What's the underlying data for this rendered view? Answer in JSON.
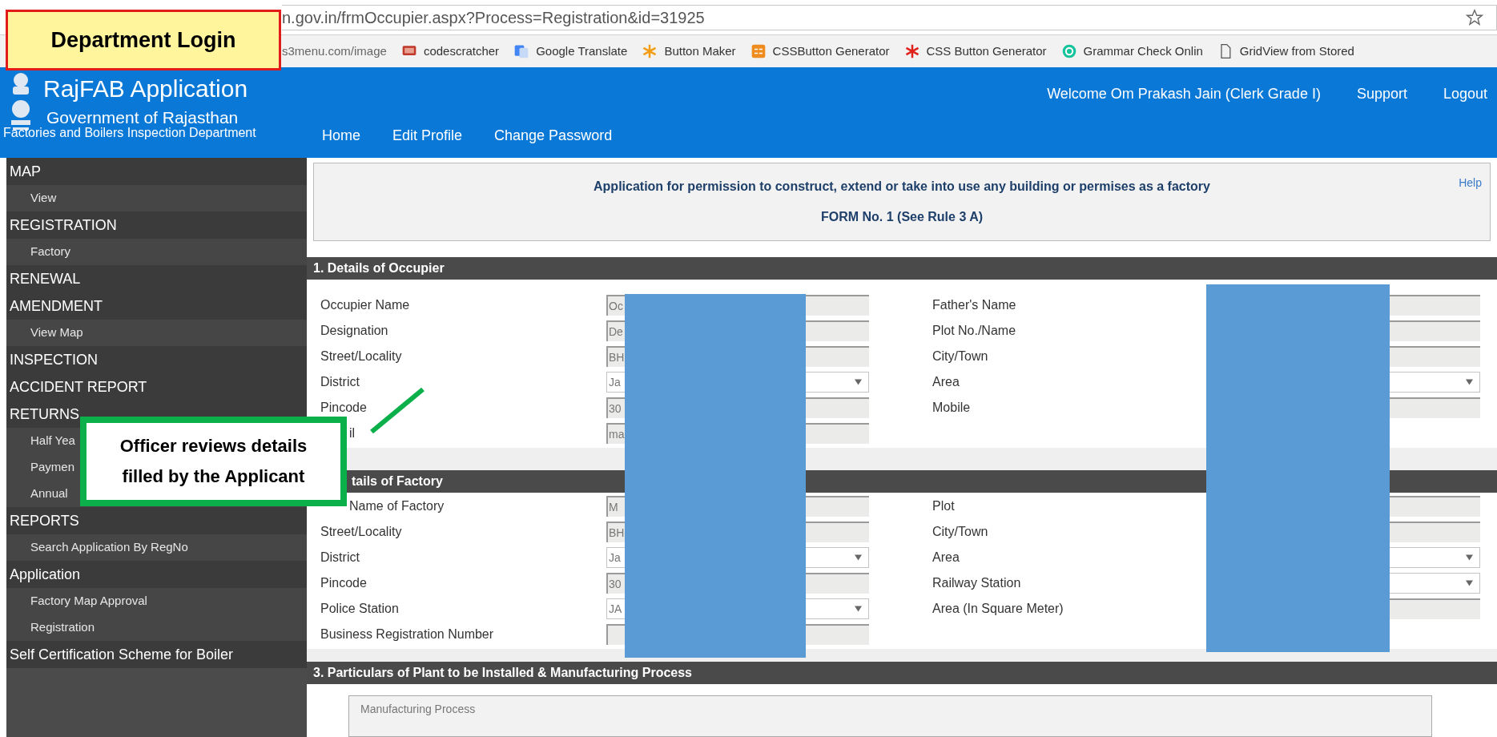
{
  "annotations": {
    "title_label": "Department Login",
    "callout": "Officer reviews details filled by the Applicant"
  },
  "browser": {
    "url": "n.gov.in/frmOccupier.aspx?Process=Registration&id=31925",
    "bookmarks": [
      {
        "label": "s3menu.com/image"
      },
      {
        "label": "codescratcher"
      },
      {
        "label": "Google Translate"
      },
      {
        "label": "Button Maker"
      },
      {
        "label": "CSSButton Generator"
      },
      {
        "label": "CSS Button Generator"
      },
      {
        "label": "Grammar Check Onlin"
      },
      {
        "label": "GridView from Stored"
      }
    ]
  },
  "header": {
    "title": "RajFAB Application",
    "subtitle": "Government of Rajasthan",
    "department": "Factories and Boilers Inspection Department",
    "nav": [
      "Home",
      "Edit Profile",
      "Change Password"
    ],
    "welcome": "Welcome Om Prakash Jain (Clerk Grade I)",
    "links": [
      "Support",
      "Logout"
    ]
  },
  "sidebar": {
    "items": [
      {
        "label": "MAP",
        "children": [
          {
            "label": "View"
          }
        ]
      },
      {
        "label": "REGISTRATION",
        "children": [
          {
            "label": "Factory"
          }
        ]
      },
      {
        "label": "RENEWAL"
      },
      {
        "label": "AMENDMENT",
        "children": [
          {
            "label": "View Map"
          }
        ]
      },
      {
        "label": "INSPECTION"
      },
      {
        "label": "ACCIDENT REPORT"
      },
      {
        "label": "RETURNS",
        "children": [
          {
            "label": "Half Yea"
          },
          {
            "label": "Paymen"
          },
          {
            "label": "Annual"
          }
        ]
      },
      {
        "label": "REPORTS",
        "children": [
          {
            "label": "Search Application By RegNo"
          }
        ]
      },
      {
        "label": "Application",
        "children": [
          {
            "label": "Factory Map Approval"
          },
          {
            "label": "Registration"
          }
        ]
      },
      {
        "label": "Self Certification Scheme for Boiler"
      }
    ]
  },
  "form": {
    "title": "Application for permission to construct, extend or take into use any building or permises as a factory",
    "subtitle": "FORM No. 1 (See Rule 3 A)",
    "help": "Help",
    "sections": [
      {
        "heading": "1. Details of Occupier",
        "partial": false,
        "left": [
          {
            "label": "Occupier Name",
            "kind": "text",
            "value": "Oc"
          },
          {
            "label": "Designation",
            "kind": "text",
            "value": "De"
          },
          {
            "label": "Street/Locality",
            "kind": "text",
            "value": "BH"
          },
          {
            "label": "District",
            "kind": "select",
            "value": "Ja"
          },
          {
            "label": "Pincode",
            "kind": "text",
            "value": "30"
          },
          {
            "label": "il",
            "partial": true,
            "kind": "text",
            "value": "ma"
          }
        ],
        "right": [
          {
            "label": "Father's Name",
            "kind": "text"
          },
          {
            "label": "Plot No./Name",
            "kind": "text"
          },
          {
            "label": "City/Town",
            "kind": "text"
          },
          {
            "label": "Area",
            "kind": "select"
          },
          {
            "label": "Mobile",
            "kind": "text"
          }
        ]
      },
      {
        "heading": "tails of Factory",
        "partial": true,
        "left": [
          {
            "label": "Name of Factory",
            "partial": true,
            "kind": "text",
            "value": "M"
          },
          {
            "label": "Street/Locality",
            "kind": "text",
            "value": "BH"
          },
          {
            "label": "District",
            "kind": "select",
            "value": "Ja"
          },
          {
            "label": "Pincode",
            "kind": "text",
            "value": "30"
          },
          {
            "label": "Police Station",
            "kind": "select",
            "value": "JA"
          },
          {
            "label": "Business Registration Number",
            "kind": "text"
          }
        ],
        "right": [
          {
            "label": "Plot",
            "kind": "text"
          },
          {
            "label": "City/Town",
            "kind": "text"
          },
          {
            "label": "Area",
            "kind": "select"
          },
          {
            "label": "Railway Station",
            "kind": "select"
          },
          {
            "label": "Area (In Square Meter)",
            "kind": "text"
          }
        ]
      }
    ],
    "process": {
      "heading": "3. Particulars of Plant to be Installed & Manufacturing Process",
      "placeholder": "Manufacturing Process"
    }
  }
}
